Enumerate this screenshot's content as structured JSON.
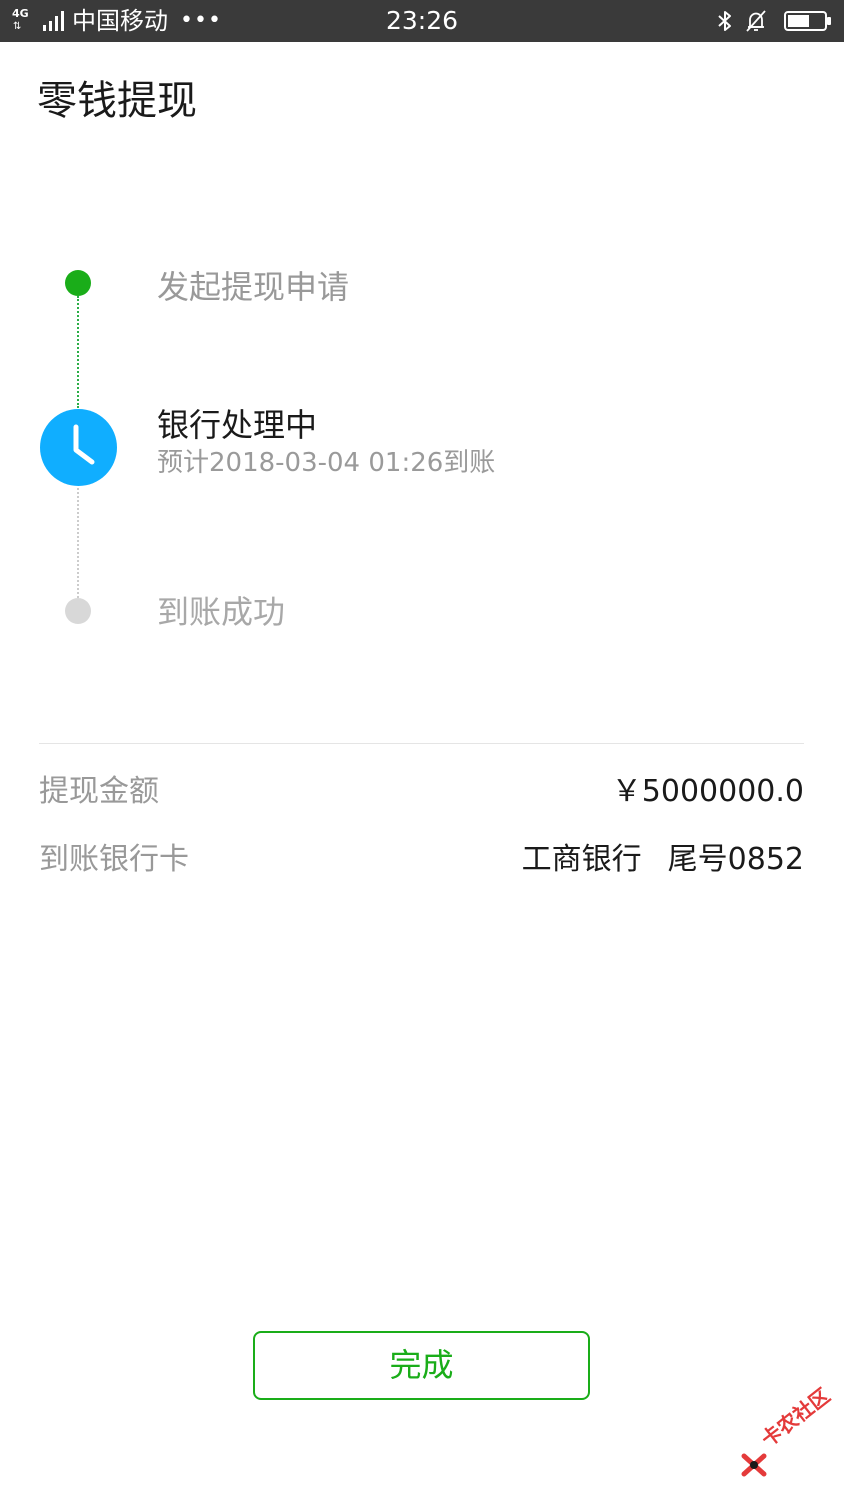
{
  "status_bar": {
    "network": "4G",
    "carrier": "中国移动",
    "more": "•••",
    "time": "23:26"
  },
  "header": {
    "title": "零钱提现"
  },
  "timeline": {
    "steps": [
      {
        "label": "发起提现申请",
        "state": "done"
      },
      {
        "label": "银行处理中",
        "sub": "预计2018-03-04 01:26到账",
        "state": "current"
      },
      {
        "label": "到账成功",
        "state": "pending"
      }
    ]
  },
  "details": {
    "amount_label": "提现金额",
    "amount_value": "￥5000000.0",
    "card_label": "到账银行卡",
    "bank_name": "工商银行",
    "card_tail": "尾号0852"
  },
  "actions": {
    "done_label": "完成"
  },
  "watermark": {
    "text": "卡农社区"
  },
  "colors": {
    "accent_green": "#1aad19",
    "clock_blue": "#10aeff",
    "status_bar_bg": "#3a3a3a"
  }
}
